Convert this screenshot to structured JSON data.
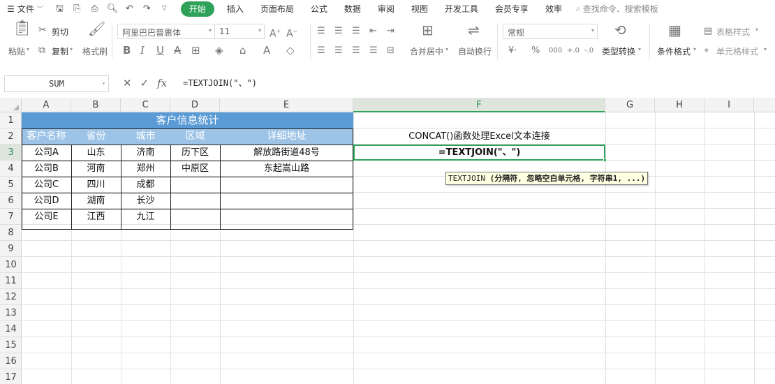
{
  "menubar": {
    "file_label": "文件",
    "tabs": [
      "开始",
      "插入",
      "页面布局",
      "公式",
      "数据",
      "审阅",
      "视图",
      "开发工具",
      "会员专享",
      "效率"
    ],
    "search_placeholder": "查找命令、搜索模板"
  },
  "ribbon": {
    "paste_label": "粘贴",
    "cut_label": "剪切",
    "copy_label": "复制",
    "format_painter_label": "格式刷",
    "font_name": "阿里巴巴普惠体",
    "font_size": "11",
    "merge_center_label": "合并居中",
    "wrap_text_label": "自动换行",
    "number_format": "常规",
    "type_convert_label": "类型转换",
    "conditional_format_label": "条件格式",
    "table_style_label": "表格样式",
    "cell_style_label": "单元格样式"
  },
  "formula_bar": {
    "name_box": "SUM",
    "formula": "=TEXTJOIN(\"、\")"
  },
  "sheet": {
    "columns": [
      "A",
      "B",
      "C",
      "D",
      "E",
      "F",
      "G",
      "H",
      "I"
    ],
    "rows": [
      "1",
      "2",
      "3",
      "4",
      "5",
      "6",
      "7",
      "8",
      "9",
      "10",
      "11",
      "12",
      "13",
      "14",
      "15",
      "16",
      "17"
    ],
    "title": "客户信息统计",
    "headers": [
      "客户名称",
      "省份",
      "城市",
      "区域",
      "详细地址"
    ],
    "data": [
      [
        "公司A",
        "山东",
        "济南",
        "历下区",
        "解放路街道48号"
      ],
      [
        "公司B",
        "河南",
        "郑州",
        "中原区",
        "东起嵩山路"
      ],
      [
        "公司C",
        "四川",
        "成都",
        "",
        ""
      ],
      [
        "公司D",
        "湖南",
        "长沙",
        "",
        ""
      ],
      [
        "公司E",
        "江西",
        "九江",
        "",
        ""
      ]
    ],
    "f2_text": "CONCAT()函数处理Excel文本连接",
    "f3_prefix": "=",
    "f3_func": "TEXTJOIN(",
    "f3_args": "\"、\")",
    "tooltip_func": "TEXTJOIN",
    "tooltip_args": "(分隔符, 忽略空白单元格, 字符串1, ...)"
  },
  "colors": {
    "accent": "#2fa25a",
    "title_fill": "#5b9bd5",
    "header_fill": "#9dc3e6"
  }
}
